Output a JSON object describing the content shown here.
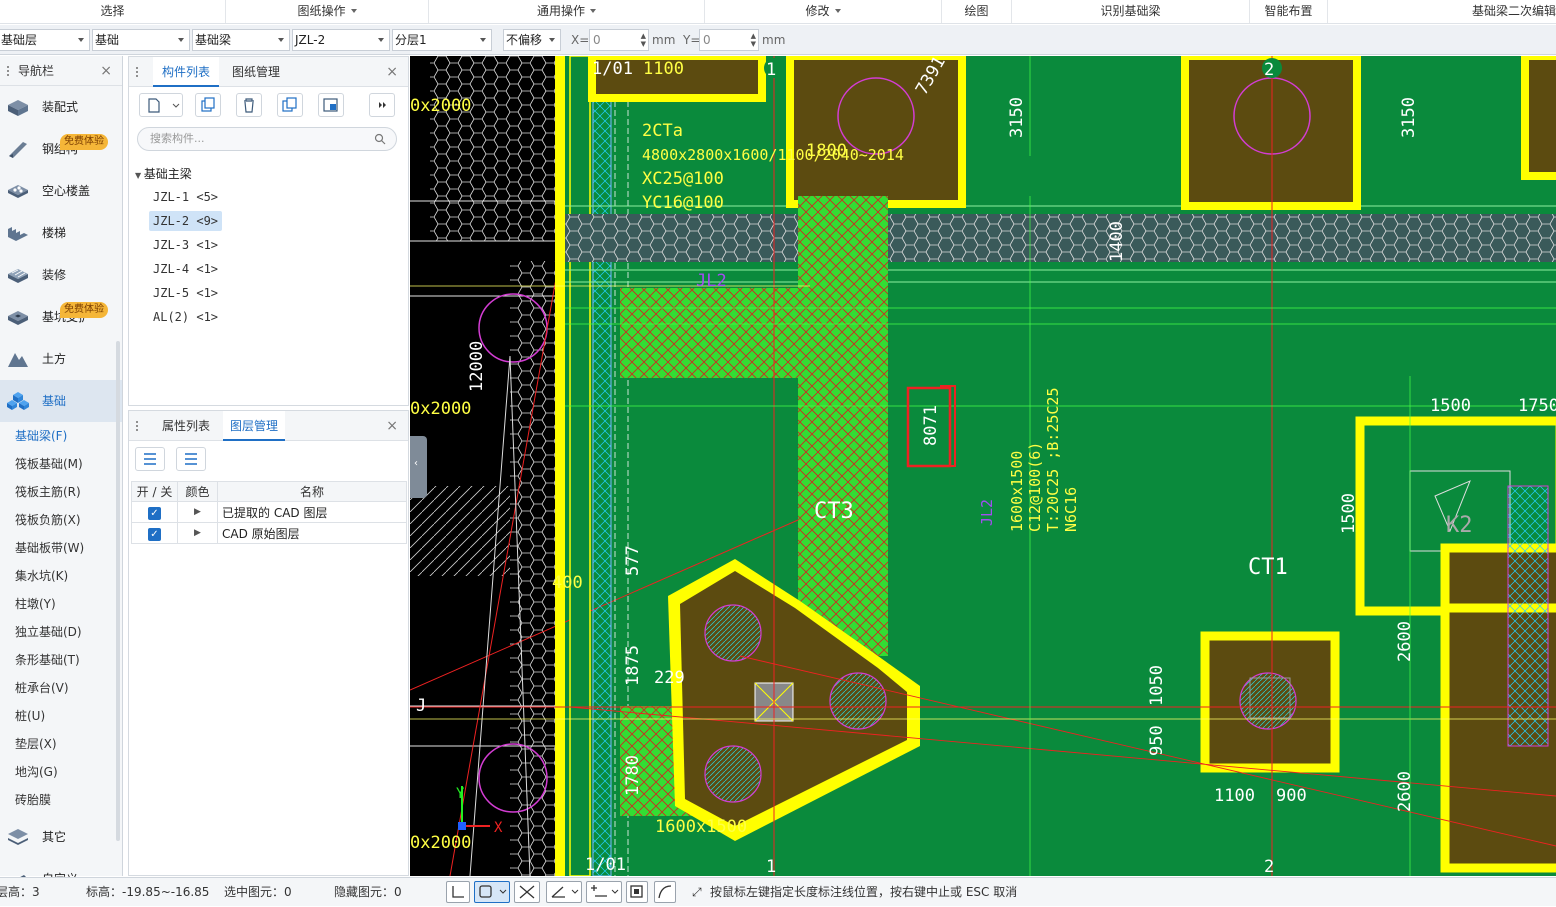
{
  "ribbon": {
    "groups": [
      {
        "label": "选择",
        "dropdown": false
      },
      {
        "label": "图纸操作",
        "dropdown": true
      },
      {
        "label": "通用操作",
        "dropdown": true
      },
      {
        "label": "修改",
        "dropdown": true
      },
      {
        "label": "绘图",
        "dropdown": false
      },
      {
        "label": "识别基础梁",
        "dropdown": false
      },
      {
        "label": "智能布置",
        "dropdown": false
      },
      {
        "label": "基础梁二次编辑",
        "dropdown": false
      }
    ]
  },
  "filters": {
    "floor": "基础层",
    "category": "基础",
    "type": "基础梁",
    "component": "JZL-2",
    "layer": "分层1",
    "offset": "不偏移",
    "x_label": "X=",
    "x_value": "0",
    "y_label": "Y=",
    "y_value": "0",
    "unit": "mm"
  },
  "nav": {
    "title": "导航栏",
    "items": [
      {
        "label": "装配式",
        "icon": "prefab-icon"
      },
      {
        "label": "钢结构",
        "icon": "steel-icon",
        "badge": "免费体验"
      },
      {
        "label": "空心楼盖",
        "icon": "hollow-slab-icon"
      },
      {
        "label": "楼梯",
        "icon": "stairs-icon"
      },
      {
        "label": "装修",
        "icon": "decoration-icon"
      },
      {
        "label": "基坑支护",
        "icon": "pit-icon",
        "badge": "免费体验"
      },
      {
        "label": "土方",
        "icon": "earthwork-icon"
      },
      {
        "label": "基础",
        "icon": "foundation-icon",
        "active": true
      }
    ],
    "sub_items": [
      {
        "label": "基础梁(F)",
        "active": true
      },
      {
        "label": "筏板基础(M)"
      },
      {
        "label": "筏板主筋(R)"
      },
      {
        "label": "筏板负筋(X)"
      },
      {
        "label": "基础板带(W)"
      },
      {
        "label": "集水坑(K)"
      },
      {
        "label": "柱墩(Y)"
      },
      {
        "label": "独立基础(D)"
      },
      {
        "label": "条形基础(T)"
      },
      {
        "label": "桩承台(V)"
      },
      {
        "label": "桩(U)"
      },
      {
        "label": "垫层(X)"
      },
      {
        "label": "地沟(G)"
      },
      {
        "label": "砖胎膜"
      }
    ],
    "bottom_items": [
      {
        "label": "其它",
        "icon": "other-icon"
      },
      {
        "label": "自定义",
        "icon": "custom-icon"
      }
    ]
  },
  "component_panel": {
    "tab_active": "构件列表",
    "tab_other": "图纸管理",
    "search_placeholder": "搜索构件...",
    "tree_root": "基础主梁",
    "items": [
      {
        "label": "JZL-1 <5>"
      },
      {
        "label": "JZL-2 <9>",
        "selected": true
      },
      {
        "label": "JZL-3 <1>"
      },
      {
        "label": "JZL-4 <1>"
      },
      {
        "label": "JZL-5 <1>"
      },
      {
        "label": "AL(2) <1>"
      }
    ]
  },
  "layer_panel": {
    "tab_other": "属性列表",
    "tab_active": "图层管理",
    "columns": [
      "开 / 关",
      "颜色",
      "名称"
    ],
    "rows": [
      {
        "checked": true,
        "name": "已提取的 CAD 图层"
      },
      {
        "checked": true,
        "name": "CAD 原始图层"
      }
    ]
  },
  "cad": {
    "labels": {
      "axis_1_top": "1",
      "axis_2_top": "2",
      "axis_1_bot": "1",
      "axis_2_bot": "2",
      "axis_1_01_top": "1/01",
      "axis_1_01_bot": "1/01",
      "axis_j": "J",
      "dim_1100": "1100",
      "ct_name": "2CTa",
      "ct_size": "4800x2800x1600/1100/2040~2014",
      "ct_xc": "XC25@100",
      "ct_yc": "YC16@100",
      "dim_7391": "7391",
      "dim_1800": "1800",
      "dim_3150a": "3150",
      "dim_3150b": "3150",
      "dim_1400": "1400",
      "dim_12000": "12000",
      "dim_0x2000a": "0x2000",
      "dim_0x2000b": "0x2000",
      "dim_0x2000c": "0x2000",
      "dim_8071": "8071",
      "beam_jl2": "JL2",
      "beam_jl2_b": "JL2",
      "beam_size": "1600x1500",
      "beam_c12": "C12@100(6)",
      "beam_t": "T:20C25 ;B:25C25",
      "beam_n": "N6C16",
      "ct3": "CT3",
      "ct1": "CT1",
      "k2": "K2",
      "dim_1500a": "1500",
      "dim_1750": "1750",
      "dim_1500b": "1500",
      "dim_2600a": "2600",
      "dim_2600b": "2600",
      "dim_1050": "1050",
      "dim_950": "950",
      "dim_1100b": "1100",
      "dim_900": "900",
      "dim_577": "577",
      "dim_1875": "1875",
      "dim_1780": "1780",
      "dim_1600x1500": "1600x1500",
      "dim_400": "400",
      "dim_229": "229",
      "coord_x": "X",
      "coord_y": "Y"
    }
  },
  "status": {
    "floor_height_label": "层高：",
    "floor_height": "3",
    "elevation_label": "标高：",
    "elevation": "-19.85~-16.85",
    "selected_label": "选中图元：",
    "selected": "0",
    "hidden_label": "隐藏图元：",
    "hidden": "0",
    "hint": "按鼠标左键指定长度标注线位置，按右键中止或 ESC 取消"
  },
  "colors": {
    "accent": "#1f6fc5",
    "cad_green": "#0a8a3c",
    "cad_yellow": "#ffff00",
    "cad_slab": "#5c4b10",
    "cad_beam": "#33dd33"
  }
}
